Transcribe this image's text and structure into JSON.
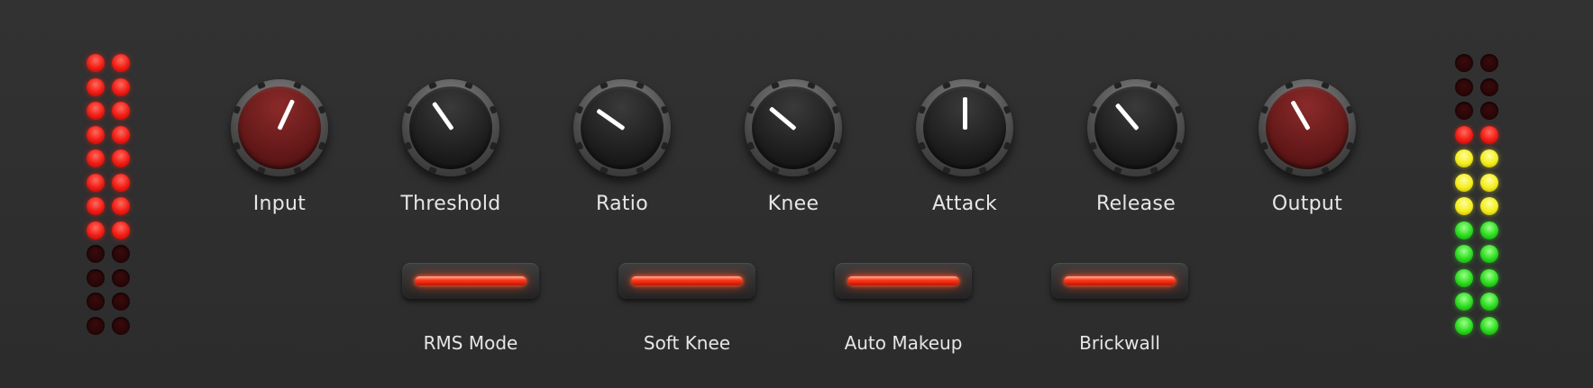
{
  "meters": {
    "left": {
      "rows": [
        "red",
        "red",
        "red",
        "red",
        "red",
        "red",
        "red",
        "red",
        "off",
        "off",
        "off",
        "off"
      ]
    },
    "right": {
      "rows": [
        "off",
        "off",
        "off",
        "red",
        "yellow",
        "yellow",
        "yellow",
        "green",
        "green",
        "green",
        "green",
        "green"
      ]
    }
  },
  "knobs": [
    {
      "label": "Input",
      "style": "red",
      "angle_deg": 25
    },
    {
      "label": "Threshold",
      "style": "dark",
      "angle_deg": -35
    },
    {
      "label": "Ratio",
      "style": "dark",
      "angle_deg": -55
    },
    {
      "label": "Knee",
      "style": "dark",
      "angle_deg": -50
    },
    {
      "label": "Attack",
      "style": "dark",
      "angle_deg": 0
    },
    {
      "label": "Release",
      "style": "dark",
      "angle_deg": -40
    },
    {
      "label": "Output",
      "style": "red",
      "angle_deg": -30
    }
  ],
  "toggles": [
    {
      "label": "RMS Mode",
      "on": true
    },
    {
      "label": "Soft Knee",
      "on": true
    },
    {
      "label": "Auto Makeup",
      "on": true
    },
    {
      "label": "Brickwall",
      "on": true
    }
  ],
  "colors": {
    "background": "#2f2f2f",
    "led_red": "#f01b13",
    "led_yellow": "#f4ee1a",
    "led_green": "#29dc1c",
    "toggle_on": "#ff3b1a"
  }
}
